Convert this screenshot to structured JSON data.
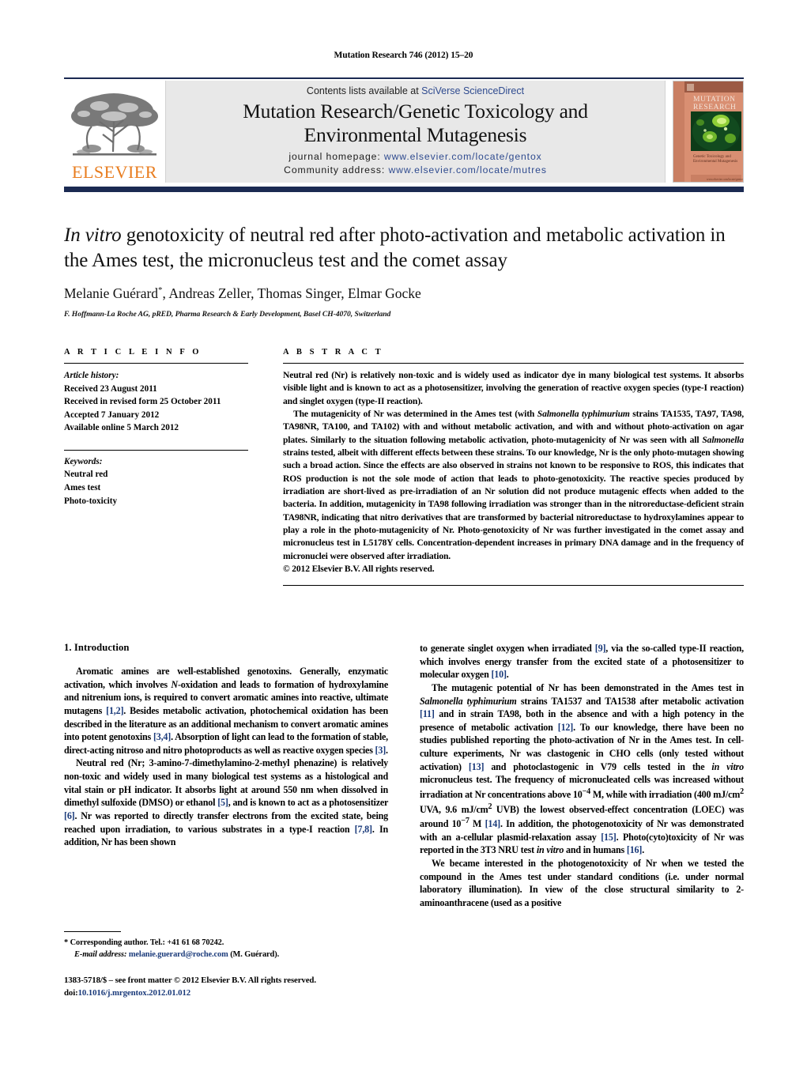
{
  "running_head": "Mutation Research 746 (2012) 15–20",
  "masthead": {
    "contents_prefix": "Contents lists available at ",
    "sciencedirect_link": "SciVerse ScienceDirect",
    "journal_title_line1": "Mutation Research/Genetic Toxicology and",
    "journal_title_line2": "Environmental Mutagenesis",
    "homepage_label": "journal homepage:",
    "homepage_url": "www.elsevier.com/locate/gentox",
    "community_label": "Community address:",
    "community_url": "www.elsevier.com/locate/mutres",
    "publisher": "ELSEVIER",
    "cover": {
      "line1": "MUTATION",
      "line2": "RESEARCH",
      "sub1": "Genetic Toxicology and",
      "sub2": "Environmental Mutagenesis",
      "bg_color": "#d98f72",
      "panel_color": "#0d3b18"
    },
    "accent_color": "#1b2a52",
    "link_color": "#2f4b8f",
    "elsevier_orange": "#E87C1E"
  },
  "title": {
    "line1_italic": "In vitro",
    "line1_rest": " genotoxicity of neutral red after photo-activation and metabolic",
    "line2": "activation in the Ames test, the micronucleus test and the comet assay"
  },
  "authors": {
    "names": "Melanie Guérard",
    "star": "*",
    "names_rest": ", Andreas Zeller, Thomas Singer, Elmar Gocke",
    "affiliation": "F. Hoffmann-La Roche AG, pRED, Pharma Research & Early Development, Basel CH-4070, Switzerland"
  },
  "article_info": {
    "label": "A R T I C L E   I N F O",
    "history_head": "Article history:",
    "history": [
      "Received 23 August 2011",
      "Received in revised form 25 October 2011",
      "Accepted 7 January 2012",
      "Available online 5 March 2012"
    ],
    "keywords_head": "Keywords:",
    "keywords": [
      "Neutral red",
      "Ames test",
      "Photo-toxicity"
    ]
  },
  "abstract": {
    "label": "A B S T R A C T",
    "para1": "Neutral red (Nr) is relatively non-toxic and is widely used as indicator dye in many biological test systems. It absorbs visible light and is known to act as a photosensitizer, involving the generation of reactive oxygen species (type-I reaction) and singlet oxygen (type-II reaction).",
    "para2_a": "The mutagenicity of Nr was determined in the Ames test (with ",
    "para2_it1": "Salmonella typhimurium",
    "para2_b": " strains TA1535, TA97, TA98, TA98NR, TA100, and TA102) with and without metabolic activation, and with and without photo-activation on agar plates. Similarly to the situation following metabolic activation, photo-mutagenicity of Nr was seen with all ",
    "para2_it2": "Salmonella",
    "para2_c": " strains tested, albeit with different effects between these strains. To our knowledge, Nr is the only photo-mutagen showing such a broad action. Since the effects are also observed in strains not known to be responsive to ROS, this indicates that ROS production is not the sole mode of action that leads to photo-genotoxicity. The reactive species produced by irradiation are short-lived as pre-irradiation of an Nr solution did not produce mutagenic effects when added to the bacteria. In addition, mutagenicity in TA98 following irradiation was stronger than in the nitroreductase-deficient strain TA98NR, indicating that nitro derivatives that are transformed by bacterial nitroreductase to hydroxylamines appear to play a role in the photo-mutagenicity of Nr. Photo-genotoxicity of Nr was further investigated in the comet assay and micronucleus test in L5178Y cells. Concentration-dependent increases in primary DNA damage and in the frequency of micronuclei were observed after irradiation.",
    "copyright": "© 2012 Elsevier B.V. All rights reserved."
  },
  "body": {
    "section_heading": "1.  Introduction",
    "left": {
      "p1_a": "Aromatic amines are well-established genotoxins. Generally, enzymatic activation, which involves ",
      "p1_it1": "N",
      "p1_b": "-oxidation and leads to formation of hydroxylamine and nitrenium ions, is required to convert aromatic amines into reactive, ultimate mutagens ",
      "p1_ref1": "[1,2]",
      "p1_c": ". Besides metabolic activation, photochemical oxidation has been described in the literature as an additional mechanism to convert aromatic amines into potent genotoxins ",
      "p1_ref2": "[3,4]",
      "p1_d": ". Absorption of light can lead to the formation of stable, direct-acting nitroso and nitro photoproducts as well as reactive oxygen species ",
      "p1_ref3": "[3]",
      "p1_e": ".",
      "p2_a": "Neutral red (Nr; 3-amino-7-dimethylamino-2-methyl phenazine) is relatively non-toxic and widely used in many biological test systems as a histological and vital stain or pH indicator. It absorbs light at around 550 nm when dissolved in dimethyl sulfoxide (DMSO) or ethanol ",
      "p2_ref1": "[5]",
      "p2_b": ", and is known to act as a photosensitizer ",
      "p2_ref2": "[6]",
      "p2_c": ". Nr was reported to directly transfer electrons from the excited state, being reached upon irradiation, to various substrates in a type-I reaction ",
      "p2_ref3": "[7,8]",
      "p2_d": ". In addition, Nr has been shown"
    },
    "right": {
      "p1_a": "to generate singlet oxygen when irradiated ",
      "p1_ref1": "[9]",
      "p1_b": ", via the so-called type-II reaction, which involves energy transfer from the excited state of a photosensitizer to molecular oxygen ",
      "p1_ref2": "[10]",
      "p1_c": ".",
      "p2_a": "The mutagenic potential of Nr has been demonstrated in the Ames test in ",
      "p2_it1": "Salmonella typhimurium",
      "p2_b": " strains TA1537 and TA1538 after metabolic activation ",
      "p2_ref1": "[11]",
      "p2_c": " and in strain TA98, both in the absence and with a high potency in the presence of metabolic activation ",
      "p2_ref2": "[12]",
      "p2_d": ". To our knowledge, there have been no studies published reporting the photo-activation of Nr in the Ames test. In cell-culture experiments, Nr was clastogenic in CHO cells (only tested without activation) ",
      "p2_ref3": "[13]",
      "p2_e": " and photoclastogenic in V79 cells tested in the ",
      "p2_it2": "in vitro",
      "p2_f": " micronucleus test. The frequency of micronucleated cells was increased without irradiation at Nr concentrations above 10",
      "p2_sup1": "−4",
      "p2_g": " M, while with irradiation (400 mJ/cm",
      "p2_sup2": "2",
      "p2_h": " UVA, 9.6 mJ/cm",
      "p2_sup3": "2",
      "p2_i": " UVB) the lowest observed-effect concentration (LOEC) was around 10",
      "p2_sup4": "−7",
      "p2_j": " M ",
      "p2_ref4": "[14]",
      "p2_k": ". In addition, the photogenotoxicity of Nr was demonstrated with an a-cellular plasmid-relaxation assay ",
      "p2_ref5": "[15]",
      "p2_l": ". Photo(cyto)toxicity of Nr was reported in the 3T3 NRU test ",
      "p2_it3": "in vitro",
      "p2_m": " and in humans ",
      "p2_ref6": "[16]",
      "p2_n": ".",
      "p3": "We became interested in the photogenotoxicity of Nr when we tested the compound in the Ames test under standard conditions (i.e. under normal laboratory illumination). In view of the close structural similarity to 2-aminoanthracene (used as a positive"
    }
  },
  "footnote": {
    "star": "*",
    "corresponding": " Corresponding author. Tel.: +41 61 68 70242.",
    "email_label": "E-mail address:",
    "email": "melanie.guerard@roche.com",
    "email_suffix": " (M. Guérard)."
  },
  "colophon": {
    "line1": "1383-5718/$ – see front matter © 2012 Elsevier B.V. All rights reserved.",
    "doi_label": "doi:",
    "doi_value": "10.1016/j.mrgentox.2012.01.012"
  }
}
